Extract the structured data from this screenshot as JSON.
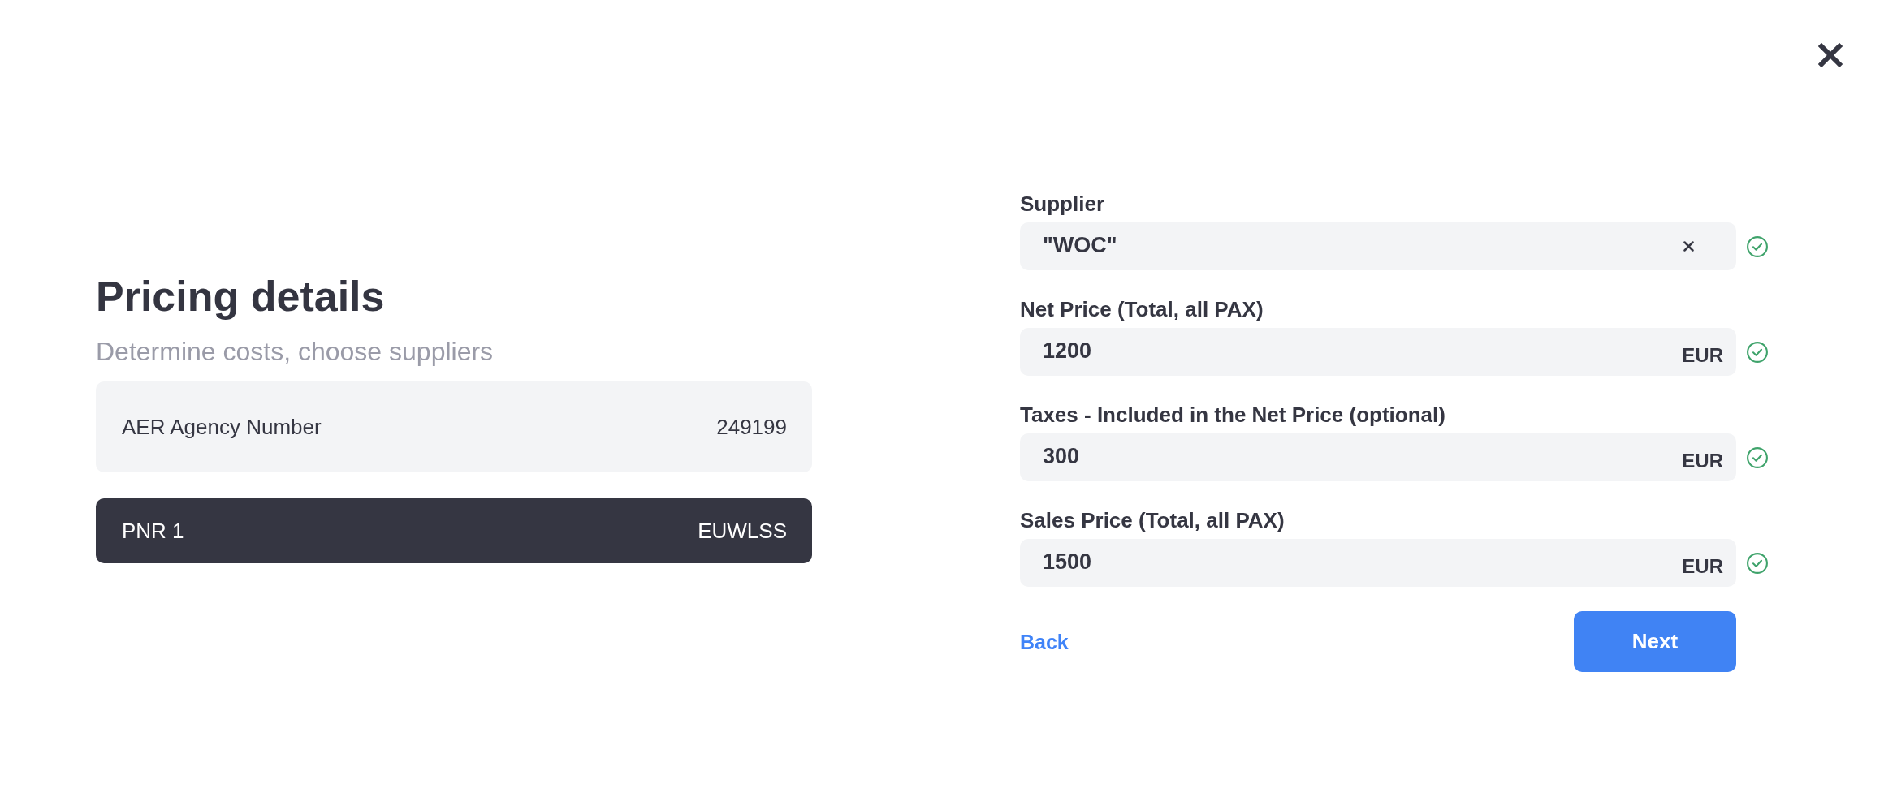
{
  "header": {
    "title": "Pricing details",
    "subtitle": "Determine costs, choose suppliers"
  },
  "info_cards": [
    {
      "label": "AER Agency Number",
      "value": "249199",
      "selected": false
    },
    {
      "label": "PNR 1",
      "value": "EUWLSS",
      "selected": true
    }
  ],
  "form": {
    "fields": [
      {
        "label": "Supplier",
        "value": "\"WOC\"",
        "clearable": true,
        "valid": true
      },
      {
        "label": "Net Price (Total, all PAX)",
        "value": "1200",
        "unit": "EUR",
        "clearable": false,
        "valid": true
      },
      {
        "label": "Taxes - Included in the Net Price (optional)",
        "value": "300",
        "unit": "EUR",
        "clearable": false,
        "valid": true
      },
      {
        "label": "Sales Price (Total, all PAX)",
        "value": "1500",
        "unit": "EUR",
        "clearable": false,
        "valid": true
      }
    ]
  },
  "actions": {
    "back": "Back",
    "next": "Next"
  }
}
